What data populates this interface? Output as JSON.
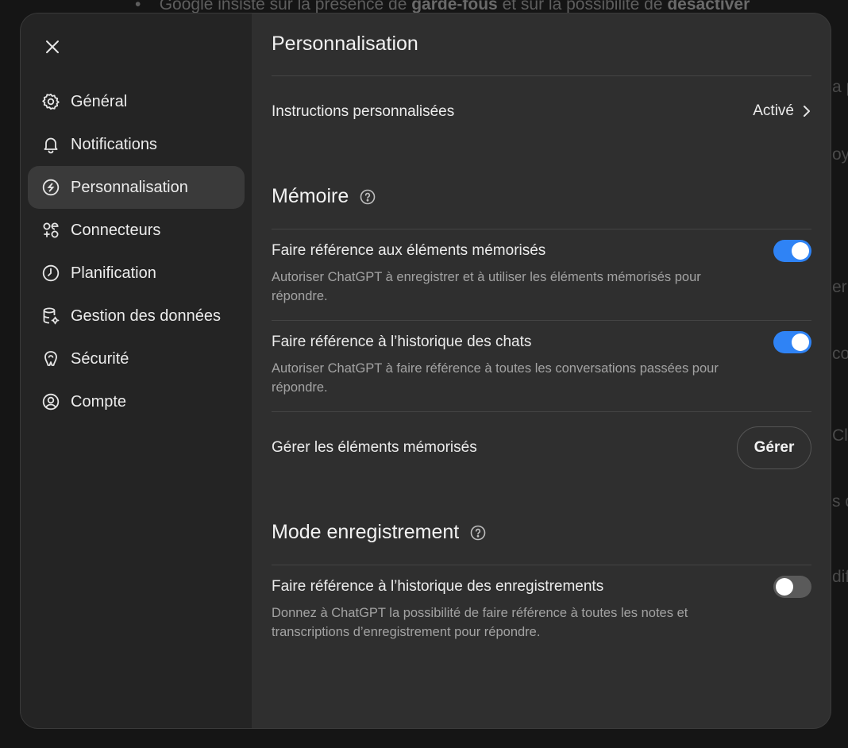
{
  "background": {
    "top_line_prefix": "Google insiste sur la présence de ",
    "top_line_bold1": "garde-fous",
    "top_line_mid": " et sur la possibilité de ",
    "top_line_bold2": "désactiver",
    "right_edge_fragments": [
      "a p",
      "oy",
      "er",
      "co",
      "Cl",
      "s d",
      "dif"
    ]
  },
  "sidebar": {
    "items": [
      {
        "label": "Général",
        "icon": "gear-icon"
      },
      {
        "label": "Notifications",
        "icon": "bell-icon"
      },
      {
        "label": "Personnalisation",
        "icon": "personalization-icon",
        "active": true
      },
      {
        "label": "Connecteurs",
        "icon": "connectors-icon"
      },
      {
        "label": "Planification",
        "icon": "clock-icon"
      },
      {
        "label": "Gestion des données",
        "icon": "database-icon"
      },
      {
        "label": "Sécurité",
        "icon": "security-icon"
      },
      {
        "label": "Compte",
        "icon": "account-icon"
      }
    ]
  },
  "main": {
    "title": "Personnalisation",
    "custom_instructions": {
      "label": "Instructions personnalisées",
      "status": "Activé"
    },
    "memory": {
      "title": "Mémoire",
      "saved_memories": {
        "label": "Faire référence aux éléments mémorisés",
        "desc": "Autoriser ChatGPT à enregistrer et à utiliser les éléments mémorisés pour répondre.",
        "enabled": true
      },
      "chat_history": {
        "label": "Faire référence à l’historique des chats",
        "desc": "Autoriser ChatGPT à faire référence à toutes les conversations passées pour répondre.",
        "enabled": true
      },
      "manage": {
        "label": "Gérer les éléments mémorisés",
        "button": "Gérer"
      }
    },
    "record_mode": {
      "title": "Mode enregistrement",
      "record_history": {
        "label": "Faire référence à l’historique des enregistrements",
        "desc": "Donnez à ChatGPT la possibilité de faire référence à toutes les notes et transcriptions d’enregistrement pour répondre.",
        "enabled": false
      }
    }
  },
  "colors": {
    "toggle_on": "#2f83f5",
    "toggle_off": "#5a5a5a",
    "modal_bg": "#2f2f2f",
    "sidebar_bg": "#242424"
  }
}
